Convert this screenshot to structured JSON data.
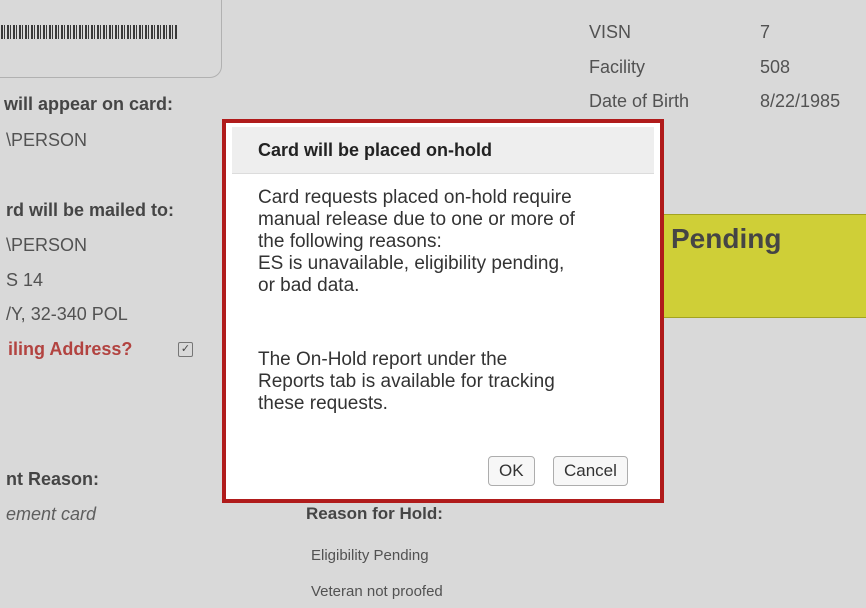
{
  "background": {
    "left_panel": {
      "name_heading": "will appear on card:",
      "name_value": "\\PERSON",
      "mail_heading": "rd will be mailed to:",
      "mail_name": "\\PERSON",
      "mail_line1": "S 14",
      "mail_line2": "/Y, 32-340 POL",
      "mailing_address_label": "iling Address?",
      "mailing_address_checked": "✓",
      "reason_heading": "nt Reason:",
      "reason_value": "ement card"
    },
    "right_panel": {
      "visn_label": "VISN",
      "visn_value": "7",
      "facility_label": "Facility",
      "facility_value": "508",
      "dob_label": "Date of Birth",
      "dob_value": "8/22/1985",
      "status_text": "Pending"
    },
    "hold_section": {
      "heading": "Reason for Hold:",
      "reasons": [
        "Eligibility Pending",
        "Veteran not proofed"
      ]
    }
  },
  "dialog": {
    "title": "Card will be placed on-hold",
    "paragraph1_lines": [
      "Card requests placed on-hold require",
      "manual release due to one or more of",
      "the following reasons:",
      "ES is unavailable, eligibility pending,",
      "or bad data."
    ],
    "paragraph2_lines": [
      "The On-Hold report under the",
      "Reports tab is available for tracking",
      "these requests."
    ],
    "ok_label": "OK",
    "cancel_label": "Cancel"
  },
  "colors": {
    "dialog_border": "#b01b1b",
    "status_banner": "#f2f21f",
    "red_label": "#c9302c"
  }
}
